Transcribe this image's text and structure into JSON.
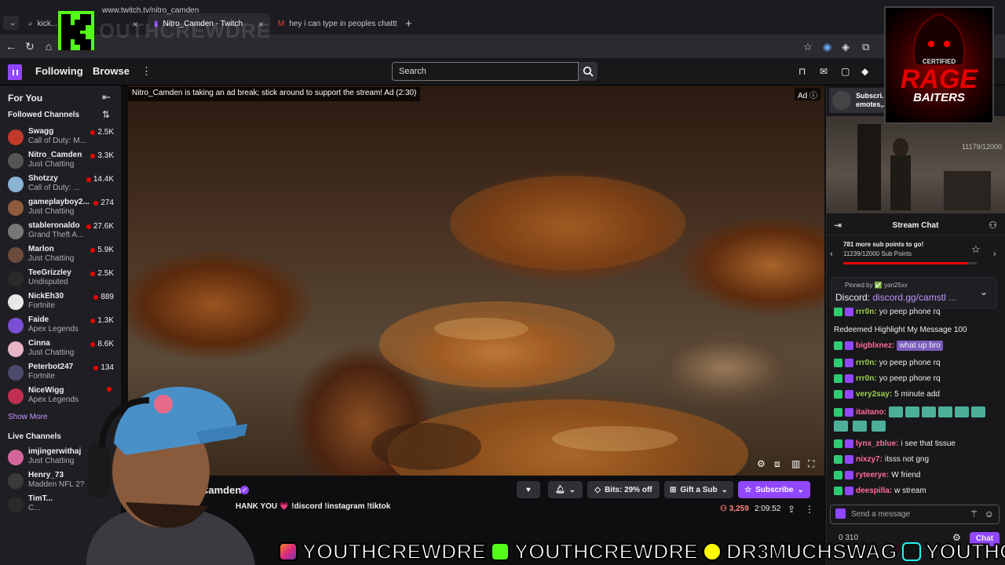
{
  "browser": {
    "tabs": [
      {
        "label": "kick..."
      },
      {
        "label": "Nitro_Camden - Twitch"
      },
      {
        "label": "hey i can type in peoples chattt - y"
      }
    ],
    "url": "www.twitch.tv/nitro_camden"
  },
  "topnav": {
    "following": "Following",
    "browse": "Browse",
    "search_placeholder": "Search"
  },
  "sidebar": {
    "for_you": "For You",
    "followed_channels": "Followed Channels",
    "channels": [
      {
        "name": "Swagg",
        "game": "Call of Duty: M...",
        "viewers": "2.5K",
        "color": "#c0392b"
      },
      {
        "name": "Nitro_Camden",
        "game": "Just Chatting",
        "viewers": "3.3K",
        "color": "#555"
      },
      {
        "name": "Shotzzy",
        "game": "Call of Duty: ...",
        "viewers": "14.4K",
        "color": "#8ab4d4"
      },
      {
        "name": "gameplayboy2...",
        "game": "Just Chatting",
        "viewers": "274",
        "color": "#8d5a3c"
      },
      {
        "name": "stableronaldo",
        "game": "Grand Theft A...",
        "viewers": "27.6K",
        "color": "#777"
      },
      {
        "name": "Marlon",
        "game": "Just Chatting",
        "viewers": "5.9K",
        "color": "#6b4b3a"
      },
      {
        "name": "TeeGrizzley",
        "game": "Undisputed",
        "viewers": "2.5K",
        "color": "#2a2a2a"
      },
      {
        "name": "NickEh30",
        "game": "Fortnite",
        "viewers": "889",
        "color": "#e8e8e8"
      },
      {
        "name": "Faide",
        "game": "Apex Legends",
        "viewers": "1.3K",
        "color": "#7b4fd4"
      },
      {
        "name": "Cinna",
        "game": "Just Chatting",
        "viewers": "8.6K",
        "color": "#e8b4c8"
      },
      {
        "name": "Peterbot247",
        "game": "Fortnite",
        "viewers": "134",
        "color": "#4a4a6a"
      },
      {
        "name": "NiceWigg",
        "game": "Apex Legends",
        "viewers": "",
        "color": "#c03050"
      }
    ],
    "show_more": "Show More",
    "live_channels": "Live Channels",
    "live": [
      {
        "name": "imjingerwithaj",
        "game": "Just Chatting",
        "color": "#d4669a"
      },
      {
        "name": "Henry_73",
        "game": "Madden NFL 2?",
        "color": "#3a3a3a"
      },
      {
        "name": "TimT...",
        "game": "C...",
        "color": "#2a2a2a"
      }
    ]
  },
  "video": {
    "ad_notice": "Nitro_Camden is taking an ad break; stick around to support the stream! Ad (2:30)",
    "ad_tag": "Ad"
  },
  "channel": {
    "name": "Camden",
    "title": "HANK YOU 💗 !discord !instagram !tiktok",
    "viewers": "3,259",
    "uptime": "2:09:52",
    "bits_label": "Bits: 29% off",
    "gift_label": "Gift a Sub",
    "subscribe_label": "Subscribe"
  },
  "chat": {
    "promo": "Subscri... emotes,...",
    "cam_count": "11179/12000",
    "header": "Stream Chat",
    "goal_line1": "781 more sub points to go!",
    "goal_line2": "11239/12000 Sub Points",
    "goal_progress": 0.935,
    "pinned_by": "Pinned by ✅ yan25xx",
    "pinned_prefix": "Discord:",
    "pinned_link": "discord.gg/camstl ...",
    "messages": [
      {
        "user": "rrr0n:",
        "color": "#9bd14a",
        "text": "yo peep phone rq"
      },
      {
        "user": "",
        "color": "#efeff1",
        "text": "Redeemed Highlight My Message  100"
      },
      {
        "user": "bigblxnez:",
        "color": "#ff6b9d",
        "text": "what up bro"
      },
      {
        "user": "rrr0n:",
        "color": "#9bd14a",
        "text": "yo peep phone rq"
      },
      {
        "user": "rrr0n:",
        "color": "#9bd14a",
        "text": "yo peep phone rq"
      },
      {
        "user": "very2say:",
        "color": "#9bd14a",
        "text": "5 minute add"
      },
      {
        "user": "itaitano:",
        "color": "#ff6b9d",
        "text": ""
      },
      {
        "user": "lynx_zblue:",
        "color": "#ff6b9d",
        "text": "i see that tissue"
      },
      {
        "user": "nixzy7:",
        "color": "#ff6b9d",
        "text": "itsss not gng"
      },
      {
        "user": "ryteerye:",
        "color": "#ff6b9d",
        "text": "W friend"
      },
      {
        "user": "deespilla:",
        "color": "#ff6b9d",
        "text": "w stream"
      }
    ],
    "input_placeholder": "Send a message",
    "counts": "0   310",
    "chat_button": "Chat"
  },
  "overlay": {
    "watermark": "OUTHCREWDRE",
    "rage_certified": "CERTIFIED",
    "rage_word": "RAGE",
    "rage_bait": "BAITERS",
    "banner": [
      "YOUTHCREWDRE",
      "YOUTHCREWDRE",
      "DR3MUCHSWAG",
      "YOUTHCREWDRE"
    ]
  }
}
